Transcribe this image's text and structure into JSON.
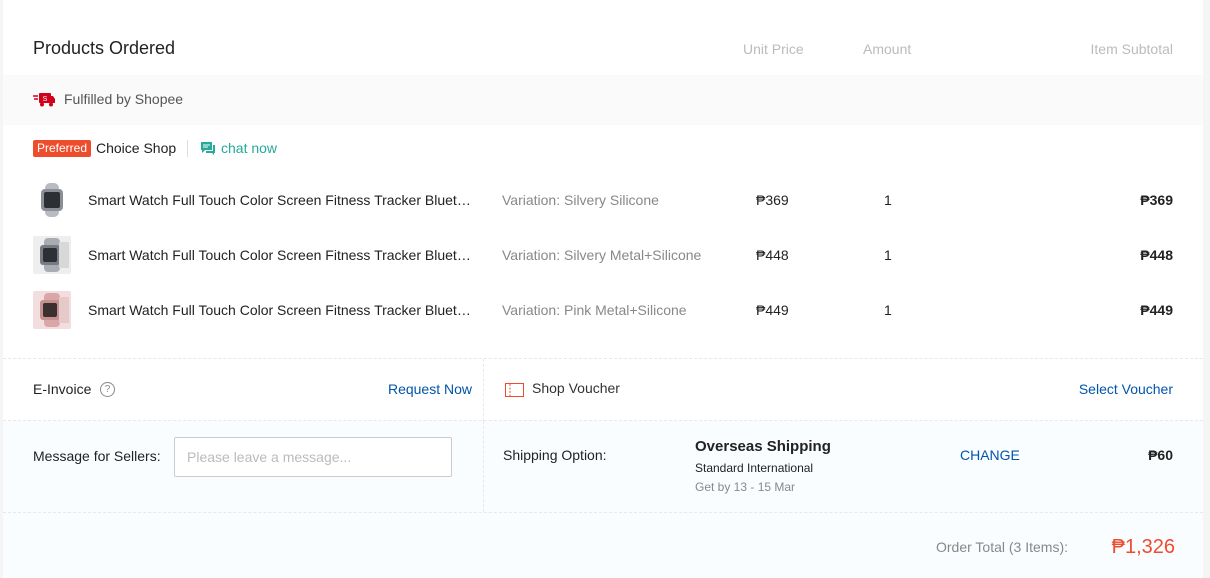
{
  "header": {
    "title": "Products Ordered",
    "col_unit_price": "Unit Price",
    "col_amount": "Amount",
    "col_item_subtotal": "Item Subtotal"
  },
  "fulfillment": {
    "text": "Fulfilled by Shopee",
    "icon": "shopee-truck-icon",
    "icon_color": "#d0011b"
  },
  "shop": {
    "badge": "Preferred",
    "badge_color": "#ee4d2d",
    "name": "Choice Shop",
    "chat_label": "chat now",
    "chat_color": "#26aa99"
  },
  "items": [
    {
      "name": "Smart Watch Full Touch Color Screen Fitness Tracker Bluetooth",
      "variation": "Variation: Silvery Silicone",
      "unit_price": "₱369",
      "amount": "1",
      "subtotal": "₱369"
    },
    {
      "name": "Smart Watch Full Touch Color Screen Fitness Tracker Bluetooth",
      "variation": "Variation: Silvery Metal+Silicone",
      "unit_price": "₱448",
      "amount": "1",
      "subtotal": "₱448"
    },
    {
      "name": "Smart Watch Full Touch Color Screen Fitness Tracker Bluetooth",
      "variation": "Variation: Pink Metal+Silicone",
      "unit_price": "₱449",
      "amount": "1",
      "subtotal": "₱449"
    }
  ],
  "einvoice": {
    "label": "E-Invoice",
    "help_icon": "?",
    "action": "Request Now"
  },
  "voucher": {
    "label": "Shop Voucher",
    "action": "Select Voucher"
  },
  "message": {
    "label": "Message for Sellers:",
    "placeholder": "Please leave a message...",
    "value": ""
  },
  "shipping": {
    "label": "Shipping Option:",
    "method": "Overseas Shipping",
    "service": "Standard International",
    "eta": "Get by 13 - 15 Mar",
    "change": "CHANGE",
    "fee": "₱60"
  },
  "order_total": {
    "label": "Order Total (3 Items):",
    "value": "₱1,326",
    "color": "#ee4d2d"
  },
  "colors": {
    "accent": "#ee4d2d",
    "link": "#05a",
    "chat": "#26aa99"
  }
}
